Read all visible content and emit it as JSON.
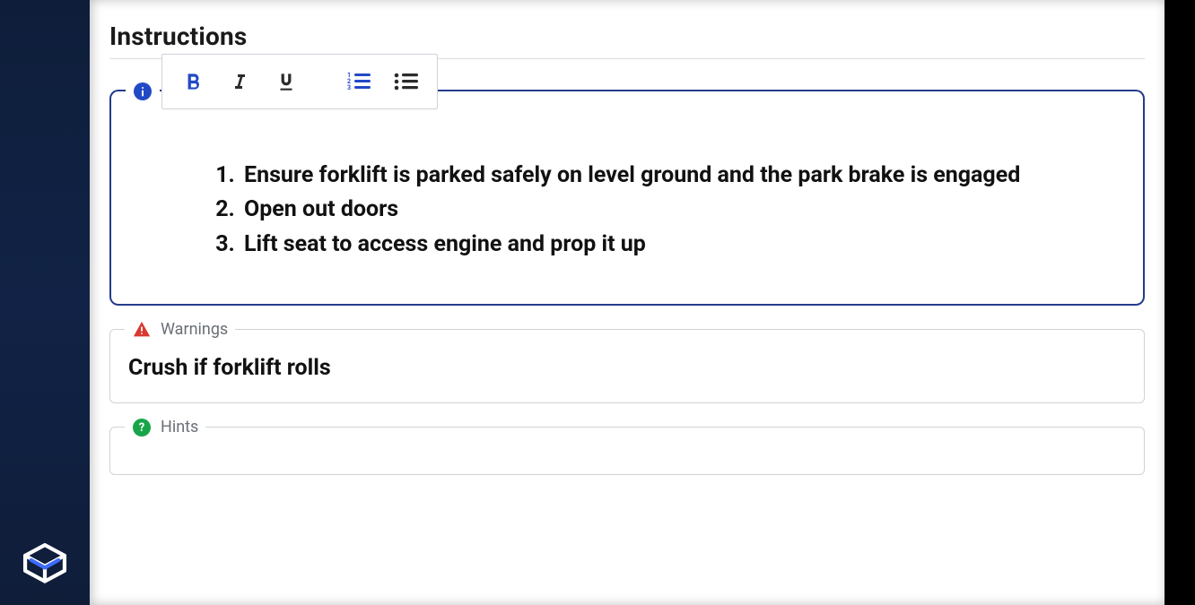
{
  "section": {
    "title": "Instructions"
  },
  "toolbar": {
    "bold": "B",
    "italic": "I",
    "underline": "U",
    "orderedList": "ordered-list",
    "unorderedList": "unordered-list"
  },
  "instructions": {
    "icon": "info-icon",
    "items": [
      "Ensure forklift is parked safely on level ground and the park brake is engaged",
      "Open out doors",
      "Lift seat to access engine and prop it up"
    ]
  },
  "warnings": {
    "label": "Warnings",
    "text": "Crush if forklift rolls"
  },
  "hints": {
    "label": "Hints"
  },
  "colors": {
    "accent": "#2249c5",
    "border": "#243b8c",
    "warn": "#d93831",
    "ok": "#18a54a"
  }
}
